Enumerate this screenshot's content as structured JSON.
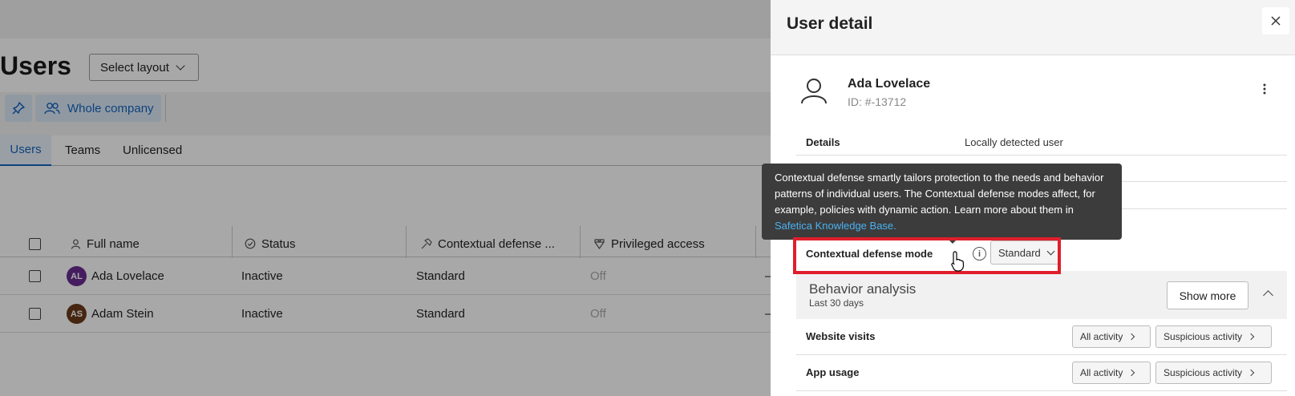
{
  "page": {
    "title": "Users",
    "layout_select": "Select layout",
    "company_filter": "Whole company",
    "tabs": [
      {
        "label": "Users",
        "active": true
      },
      {
        "label": "Teams",
        "active": false
      },
      {
        "label": "Unlicensed",
        "active": false
      }
    ],
    "table": {
      "columns": [
        "Full name",
        "Status",
        "Contextual defense ...",
        "Privileged access"
      ],
      "rows": [
        {
          "initials": "AL",
          "avatar_color": "#6a2c8f",
          "name": "Ada Lovelace",
          "status": "Inactive",
          "mode": "Standard",
          "privileged": "Off",
          "extra": "–"
        },
        {
          "initials": "AS",
          "avatar_color": "#6b3a1a",
          "name": "Adam Stein",
          "status": "Inactive",
          "mode": "Standard",
          "privileged": "Off",
          "extra": "–"
        }
      ]
    }
  },
  "drawer": {
    "title": "User detail",
    "close_icon": "close-icon",
    "user": {
      "name": "Ada Lovelace",
      "id": "ID: #-13712"
    },
    "details_label": "Details",
    "details_value": "Locally detected user",
    "cdm_label": "Contextual defense mode",
    "cdm_value": "Standard",
    "info_icon_glyph": "i",
    "behavior": {
      "title": "Behavior analysis",
      "subtitle": "Last 30 days",
      "show_more": "Show more"
    },
    "activities": [
      {
        "label": "Website visits",
        "all": "All activity",
        "suspicious": "Suspicious activity"
      },
      {
        "label": "App usage",
        "all": "All activity",
        "suspicious": "Suspicious activity"
      }
    ]
  },
  "tooltip": {
    "text": "Contextual defense smartly tailors protection to the needs and behavior patterns of individual users. The Contextual defense modes affect, for example, policies with dynamic action. Learn more about them in ",
    "link": "Safetica Knowledge Base."
  },
  "colors": {
    "accent": "#1565c0",
    "highlight": "#e01e2b",
    "tooltip_bg": "#3c3c3c",
    "link": "#4ab1f0"
  }
}
